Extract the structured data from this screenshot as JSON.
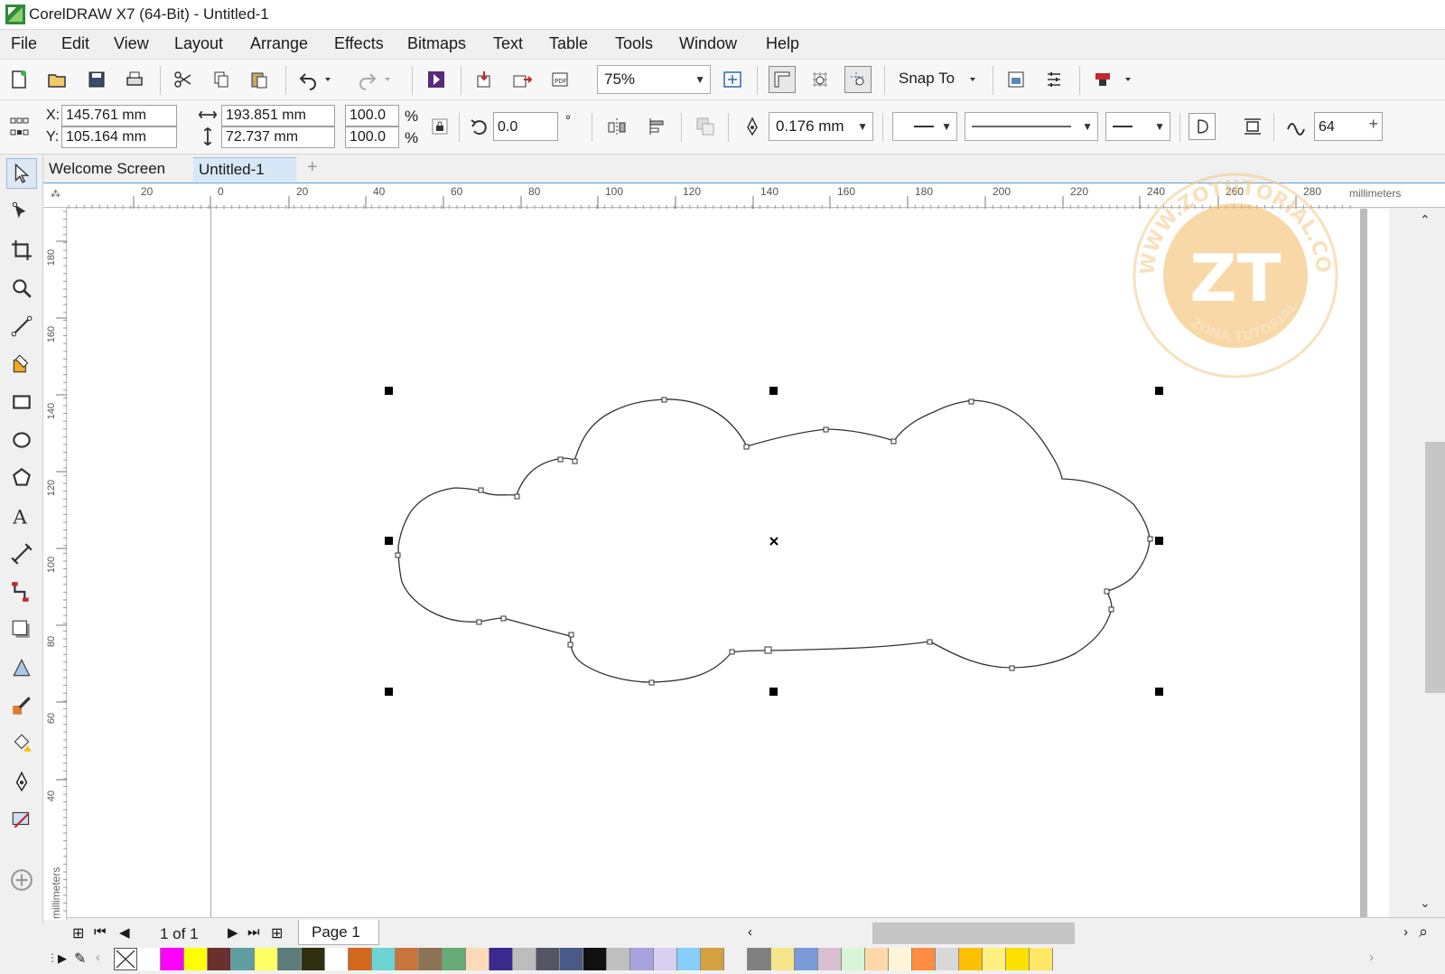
{
  "window": {
    "title": "CorelDRAW X7 (64-Bit) - Untitled-1"
  },
  "menu": [
    "File",
    "Edit",
    "View",
    "Layout",
    "Arrange",
    "Effects",
    "Bitmaps",
    "Text",
    "Table",
    "Tools",
    "Window",
    "Help"
  ],
  "toolbar": {
    "zoom": "75%",
    "snap_to": "Snap To",
    "icons": [
      "new-document-icon",
      "open-icon",
      "save-icon",
      "print-icon",
      "cut-icon",
      "copy-icon",
      "paste-icon",
      "undo-icon",
      "redo-icon",
      "search-content-icon",
      "import-icon",
      "export-icon",
      "publish-pdf-icon",
      "full-screen-preview-icon",
      "show-rulers-icon",
      "show-grid-icon",
      "show-guidelines-icon",
      "welcome-screen-icon",
      "options-icon",
      "application-launcher-icon"
    ]
  },
  "properties": {
    "x_label": "X:",
    "x_value": "145.761 mm",
    "y_label": "Y:",
    "y_value": "105.164 mm",
    "width_value": "193.851 mm",
    "height_value": "72.737 mm",
    "scale_x": "100.0",
    "scale_y": "100.0",
    "percent": "%",
    "rotation": "0.0",
    "degree": "°",
    "outline_width": "0.176 mm",
    "smoothing": "64"
  },
  "tabs": {
    "welcome": "Welcome Screen",
    "document": "Untitled-1",
    "add": "+"
  },
  "ruler": {
    "h_labels": [
      "20",
      "0",
      "20",
      "40",
      "60",
      "80",
      "100",
      "120",
      "140",
      "160",
      "180",
      "200",
      "220",
      "240",
      "260",
      "280"
    ],
    "h_unit": "millimeters",
    "v_labels": [
      "180",
      "160",
      "140",
      "120",
      "100",
      "80",
      "60",
      "40"
    ],
    "v_unit": "millimeters"
  },
  "pager": {
    "count": "1 of 1",
    "page_tab": "Page 1"
  },
  "watermark": {
    "text": "WWW.ZOTUTORIAL.COM",
    "initials": "ZT",
    "subtitle": "ZONA TUTORIAL"
  },
  "palette": [
    "#ffffff",
    "#ff00ff",
    "#ffff00",
    "#6b2f2f",
    "#5f9ea0",
    "#ffff66",
    "#5c7c7c",
    "#2f2f10",
    "#ffffff",
    "#d2691e",
    "#6ed3d3",
    "#c8743c",
    "#8b7355",
    "#66aa77",
    "#ffdab9",
    "#3a2a90",
    "#bdbdbd",
    "#555566",
    "#4a5a88",
    "#111111",
    "#c0c0c0",
    "#a9a2e0",
    "#d8d0f0",
    "#87cefa",
    "#d4a040",
    "#f0f0f0",
    "#808080",
    "#f5e68c",
    "#7a9ad8",
    "#d8c0d0",
    "#d8f5d8",
    "#ffd8a8",
    "#fff5d8",
    "#ff8c40",
    "#d8d8d8",
    "#ffc000",
    "#fff080",
    "#ffe000",
    "#ffe866"
  ]
}
